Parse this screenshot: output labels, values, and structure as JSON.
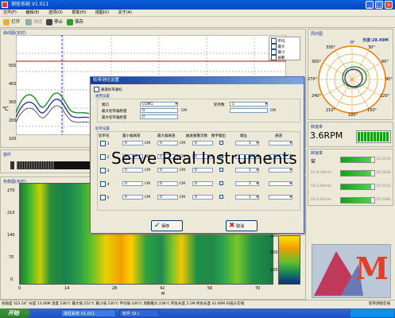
{
  "app": {
    "title": "测径系统 V1.011",
    "btn_min": "_",
    "btn_max": "□",
    "btn_close": "×"
  },
  "menu": [
    "文件(F)",
    "编辑(E)",
    "选项(O)",
    "帮助(H)",
    "视图(V)",
    "关于(A)"
  ],
  "toolbar": {
    "open": "打开",
    "edit": "测径",
    "stop": "停止",
    "save": "保存"
  },
  "graph_panel": {
    "title": "曲线图(实时)",
    "y_axis_unit": "℃",
    "yticks": [
      "500",
      "400",
      "300",
      "200",
      "100",
      "0"
    ],
    "xticks": [
      "0",
      "14"
    ],
    "legend": [
      "平均",
      "最大",
      "最小",
      "报警"
    ],
    "alarm_color": "#d40000"
  },
  "strip_panel": {
    "title": "窗纤"
  },
  "thermal_panel": {
    "title": "热像图(实时)",
    "yticks": [
      "0",
      "70",
      "140",
      "210",
      "270"
    ],
    "xticks": [
      "0",
      "14",
      "28",
      "42",
      "56",
      "70"
    ],
    "x_unit": "M",
    "scale_ticks": [
      "300",
      "200",
      "100"
    ]
  },
  "polar_panel": {
    "title": "周向图",
    "length_label": "长度:28.49M",
    "angle_labels": [
      "0°",
      "30°",
      "60°",
      "90°",
      "120°",
      "150°",
      "180°",
      "210°",
      "240°",
      "270°",
      "300°",
      "330°"
    ]
  },
  "speed_panel": {
    "title": "转速率",
    "value": "3.6RPM"
  },
  "readings_panel": {
    "title": "转速率",
    "rows": [
      {
        "label": "窑",
        "value": "16.541S"
      },
      {
        "label": "R1:6.38mm",
        "value": "16.563S"
      },
      {
        "label": "R2:2.90mm",
        "value": "16.551S"
      },
      {
        "label": "R3:4.93mm",
        "value": "16.558S"
      }
    ]
  },
  "dialog": {
    "title": "轮带测径设置",
    "enable_label": "通道标带通标",
    "general_title": "通用设置",
    "port_label": "端口",
    "port_value": "COM1",
    "wheel_count_label": "轮带数",
    "wheel_count_value": "1",
    "max_label1": "最大轮带偏移量",
    "max_value1": "0",
    "max_unit1": "CM",
    "max_label2": "最大轮带偏移量",
    "max_value2": "0",
    "max_unit2": "CM",
    "wheel_title": "轮带设置",
    "columns": [
      "轮带号",
      "最小偏离值",
      "最大偏离值",
      "触发报警次数",
      "数字输出",
      "端址",
      "通道"
    ],
    "rows": [
      {
        "no": "1",
        "min": "0",
        "min_unit": "CM",
        "max": "0",
        "max_unit": "CM",
        "count": "0",
        "addr": "1",
        "ch": ""
      },
      {
        "no": "2",
        "min": "0",
        "min_unit": "CM",
        "max": "0",
        "max_unit": "CM",
        "count": "0",
        "addr": "1",
        "ch": ""
      },
      {
        "no": "3",
        "min": "0",
        "min_unit": "CM",
        "max": "0",
        "max_unit": "CM",
        "count": "0",
        "addr": "1",
        "ch": ""
      },
      {
        "no": "4",
        "min": "0",
        "min_unit": "CM",
        "max": "0",
        "max_unit": "CM",
        "count": "0",
        "addr": "1",
        "ch": ""
      },
      {
        "no": "5",
        "min": "0",
        "min_unit": "CM",
        "max": "0",
        "max_unit": "CM",
        "count": "0",
        "addr": "1",
        "ch": ""
      }
    ],
    "save_label": "保存",
    "cancel_label": "取消"
  },
  "watermark": "Serve Real Instruments",
  "logo_letter": "M",
  "statusbar": "窑角度 323.54°  长度 13.00M  温度 236℃  最大值 252℃  最小值 230℃  平均值 240℃  周期最大:238℃  所处长度 2.2M  所处长度 43.00M  扫描头在线",
  "statusbar_right": "轮带测径在线",
  "taskbar": {
    "start": "开始",
    "task1": "测径系统 V1.011",
    "task2": "软件 (D:)",
    "clock": ""
  }
}
